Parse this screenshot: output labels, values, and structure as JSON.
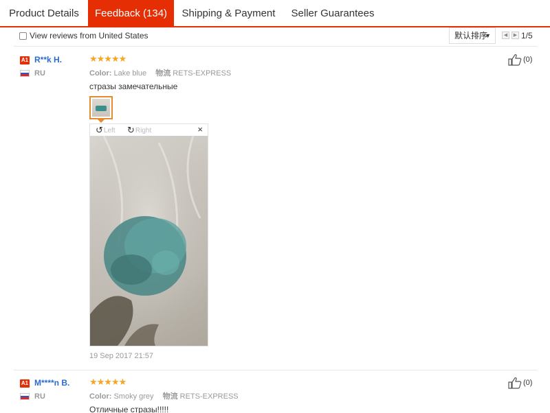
{
  "tabs": [
    {
      "label": "Product Details",
      "active": false
    },
    {
      "label": "Feedback (134)",
      "active": true
    },
    {
      "label": "Shipping & Payment",
      "active": false
    },
    {
      "label": "Seller Guarantees",
      "active": false
    }
  ],
  "filter": {
    "checkbox_label": "View reviews from United States",
    "checked": false,
    "sort_label": "默认排序",
    "pagination": "1/5"
  },
  "reviews": [
    {
      "badge": "A1",
      "name": "R**k H.",
      "country": "RU",
      "stars": "★★★★★",
      "color_label": "Color:",
      "color_value": "Lake blue",
      "shipping_label": "物流",
      "shipping_value": "RETS-EXPRESS",
      "text": "стразы замечательные",
      "likes": "(0)",
      "viewer": {
        "left": "Left",
        "right": "Right",
        "close": "×"
      },
      "date": "19 Sep 2017 21:57"
    },
    {
      "badge": "A1",
      "name": "M****n B.",
      "country": "RU",
      "stars": "★★★★★",
      "color_label": "Color:",
      "color_value": "Smoky grey",
      "shipping_label": "物流",
      "shipping_value": "RETS-EXPRESS",
      "text": "Отличные стразы!!!!!",
      "likes": "(0)"
    }
  ],
  "colors": {
    "accent": "#e62e04",
    "name_link": "#2a6bd1",
    "star": "#f5a623",
    "thumb_border": "#e58b2c"
  },
  "icons": [
    "flag-ru-icon",
    "thumbs-up-icon",
    "rotate-left-icon",
    "rotate-right-icon",
    "close-icon",
    "chevron-down-icon",
    "chevron-left-icon",
    "chevron-right-icon"
  ]
}
